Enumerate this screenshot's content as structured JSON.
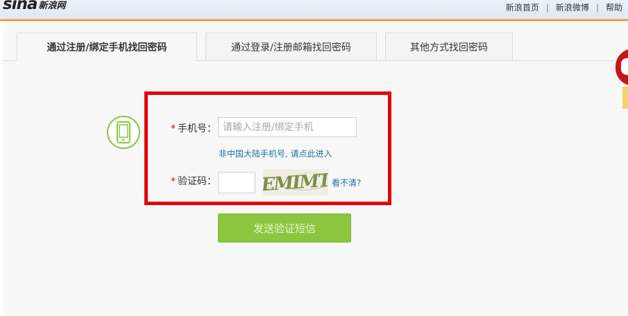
{
  "header": {
    "logo_latin": "sina",
    "logo_cn": "新浪网",
    "nav": [
      {
        "label": "新浪首页"
      },
      {
        "label": "新浪微博"
      },
      {
        "label": "帮助"
      }
    ],
    "separator": "|",
    "accent_color": "#ff8400"
  },
  "tabs": [
    {
      "label": "通过注册/绑定手机找回密码",
      "active": true
    },
    {
      "label": "通过登录/注册邮箱找回密码",
      "active": false
    },
    {
      "label": "其他方式找回密码",
      "active": false
    }
  ],
  "form": {
    "icon": "mobile-phone-icon",
    "required_mark": "*",
    "phone_label": "手机号：",
    "phone_value": "",
    "phone_placeholder": "请输入注册/绑定手机",
    "intl_link": "非中国大陆手机号, 请点此进入",
    "code_label": "验证码：",
    "code_value": "",
    "captcha_text": "EMIMT",
    "refresh_link": "看不清?",
    "submit_label": "发送验证短信",
    "highlight_color": "#e60000",
    "button_color": "#8cc63f",
    "link_color": "#1a6fb5"
  }
}
